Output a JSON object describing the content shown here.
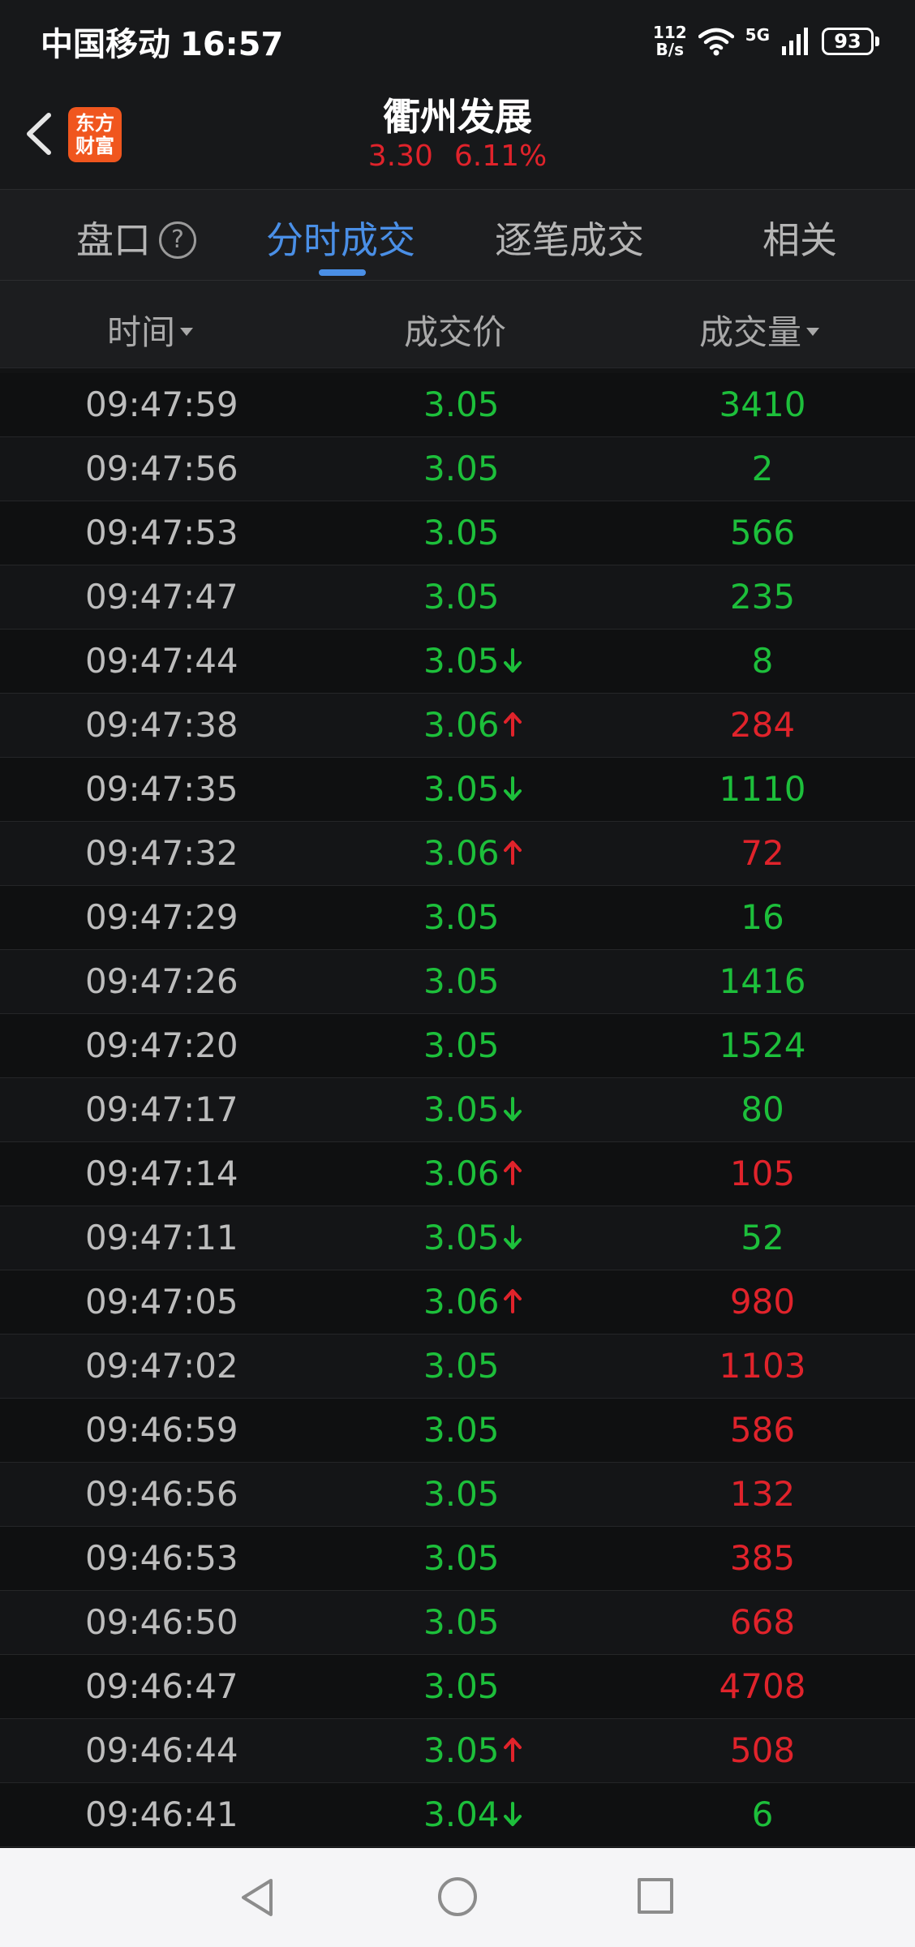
{
  "status_bar": {
    "carrier": "中国移动",
    "time": "16:57",
    "net_speed_value": "112",
    "net_speed_unit": "B/s",
    "network_type": "5G",
    "battery": "93"
  },
  "header": {
    "logo_line1": "东方",
    "logo_line2": "财富",
    "title": "衢州发展",
    "price": "3.30",
    "change_pct": "6.11%"
  },
  "tabs": [
    {
      "label": "盘口",
      "active": false
    },
    {
      "label": "分时成交",
      "active": true
    },
    {
      "label": "逐笔成交",
      "active": false
    },
    {
      "label": "相关",
      "active": false
    }
  ],
  "tab_help": "?",
  "columns": {
    "time": "时间",
    "price": "成交价",
    "volume": "成交量"
  },
  "colors": {
    "up": "#e0232b",
    "down": "#1dbf3b",
    "accent": "#4a8fe6"
  },
  "trades": [
    {
      "time": "09:47:59",
      "price": "3.05",
      "arrow": "",
      "volume": "3410",
      "dir": "down"
    },
    {
      "time": "09:47:56",
      "price": "3.05",
      "arrow": "",
      "volume": "2",
      "dir": "down"
    },
    {
      "time": "09:47:53",
      "price": "3.05",
      "arrow": "",
      "volume": "566",
      "dir": "down"
    },
    {
      "time": "09:47:47",
      "price": "3.05",
      "arrow": "",
      "volume": "235",
      "dir": "down"
    },
    {
      "time": "09:47:44",
      "price": "3.05",
      "arrow": "down",
      "volume": "8",
      "dir": "down"
    },
    {
      "time": "09:47:38",
      "price": "3.06",
      "arrow": "up",
      "volume": "284",
      "dir": "up"
    },
    {
      "time": "09:47:35",
      "price": "3.05",
      "arrow": "down",
      "volume": "1110",
      "dir": "down"
    },
    {
      "time": "09:47:32",
      "price": "3.06",
      "arrow": "up",
      "volume": "72",
      "dir": "up"
    },
    {
      "time": "09:47:29",
      "price": "3.05",
      "arrow": "",
      "volume": "16",
      "dir": "down"
    },
    {
      "time": "09:47:26",
      "price": "3.05",
      "arrow": "",
      "volume": "1416",
      "dir": "down"
    },
    {
      "time": "09:47:20",
      "price": "3.05",
      "arrow": "",
      "volume": "1524",
      "dir": "down"
    },
    {
      "time": "09:47:17",
      "price": "3.05",
      "arrow": "down",
      "volume": "80",
      "dir": "down"
    },
    {
      "time": "09:47:14",
      "price": "3.06",
      "arrow": "up",
      "volume": "105",
      "dir": "up"
    },
    {
      "time": "09:47:11",
      "price": "3.05",
      "arrow": "down",
      "volume": "52",
      "dir": "down"
    },
    {
      "time": "09:47:05",
      "price": "3.06",
      "arrow": "up",
      "volume": "980",
      "dir": "up"
    },
    {
      "time": "09:47:02",
      "price": "3.05",
      "arrow": "",
      "volume": "1103",
      "dir": "up"
    },
    {
      "time": "09:46:59",
      "price": "3.05",
      "arrow": "",
      "volume": "586",
      "dir": "up"
    },
    {
      "time": "09:46:56",
      "price": "3.05",
      "arrow": "",
      "volume": "132",
      "dir": "up"
    },
    {
      "time": "09:46:53",
      "price": "3.05",
      "arrow": "",
      "volume": "385",
      "dir": "up"
    },
    {
      "time": "09:46:50",
      "price": "3.05",
      "arrow": "",
      "volume": "668",
      "dir": "up"
    },
    {
      "time": "09:46:47",
      "price": "3.05",
      "arrow": "",
      "volume": "4708",
      "dir": "up"
    },
    {
      "time": "09:46:44",
      "price": "3.05",
      "arrow": "up",
      "volume": "508",
      "dir": "up"
    },
    {
      "time": "09:46:41",
      "price": "3.04",
      "arrow": "down",
      "volume": "6",
      "dir": "down"
    }
  ]
}
